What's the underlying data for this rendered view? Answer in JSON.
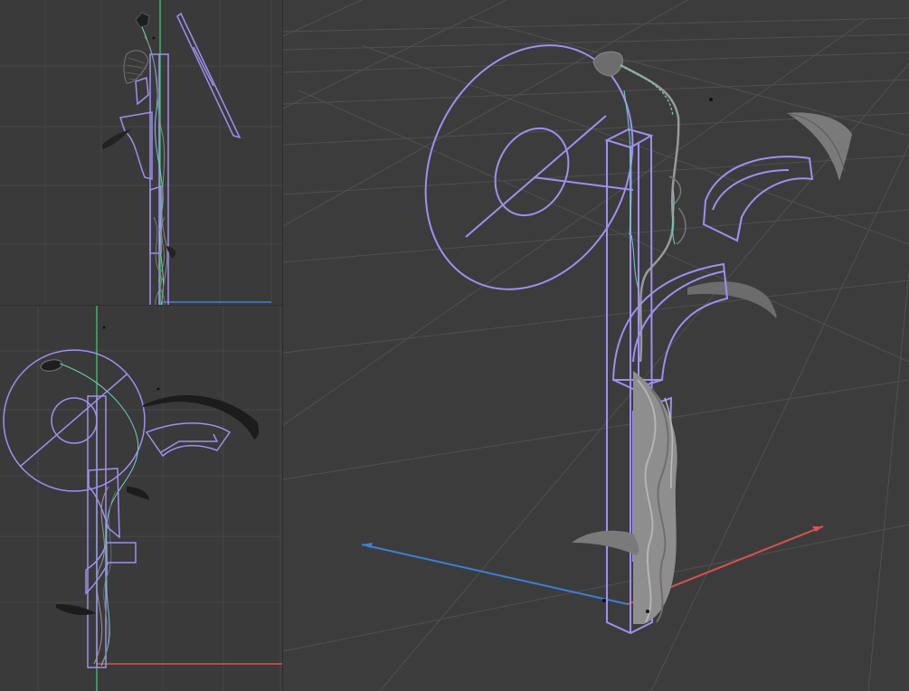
{
  "viewports": [
    {
      "id": "front-view",
      "view": "front"
    },
    {
      "id": "side-view",
      "view": "side"
    },
    {
      "id": "perspective-view",
      "view": "perspective"
    }
  ],
  "colors": {
    "background": "#3a3a3a",
    "grid": "#4a4a4a",
    "grid_axis": "#525252",
    "selection": "#a08ff0",
    "object": "#2c2c2c",
    "x_axis": "#d9524f",
    "y_axis": "#3fb26a",
    "z_axis": "#3d7fd6",
    "wire": "#6fd0c8"
  },
  "icons": [
    "axis-gizmo-icon"
  ]
}
